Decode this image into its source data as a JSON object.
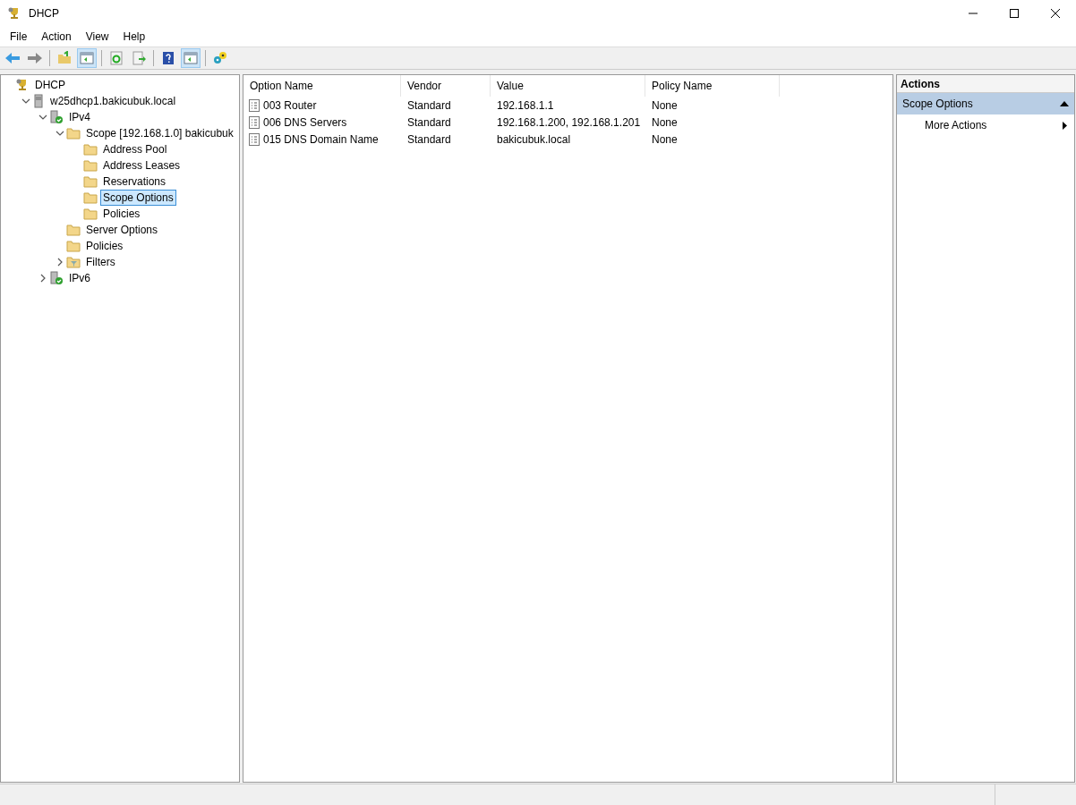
{
  "window": {
    "title": "DHCP"
  },
  "menu": [
    "File",
    "Action",
    "View",
    "Help"
  ],
  "toolbar": [
    {
      "kind": "back",
      "pressed": false
    },
    {
      "kind": "forward",
      "pressed": false
    },
    {
      "kind": "separator"
    },
    {
      "kind": "up",
      "pressed": false
    },
    {
      "kind": "pane",
      "pressed": true
    },
    {
      "kind": "separator"
    },
    {
      "kind": "refresh",
      "pressed": false
    },
    {
      "kind": "export",
      "pressed": false
    },
    {
      "kind": "separator"
    },
    {
      "kind": "help",
      "pressed": false
    },
    {
      "kind": "pane",
      "pressed": true
    },
    {
      "kind": "separator"
    },
    {
      "kind": "wizard",
      "pressed": false
    }
  ],
  "tree": [
    {
      "label": "DHCP",
      "kind": "root",
      "selected": false,
      "children": [
        {
          "label": "w25dhcp1.bakicubuk.local",
          "kind": "server",
          "expanded": true,
          "selected": false,
          "children": [
            {
              "label": "IPv4",
              "kind": "protocol",
              "expanded": true,
              "selected": false,
              "children": [
                {
                  "label": "Scope [192.168.1.0] bakicubuk",
                  "kind": "folder",
                  "expanded": true,
                  "selected": false,
                  "children": [
                    {
                      "label": "Address Pool",
                      "kind": "folder",
                      "selected": false
                    },
                    {
                      "label": "Address Leases",
                      "kind": "folder",
                      "selected": false
                    },
                    {
                      "label": "Reservations",
                      "kind": "folder",
                      "selected": false
                    },
                    {
                      "label": "Scope Options",
                      "kind": "folder",
                      "selected": true
                    },
                    {
                      "label": "Policies",
                      "kind": "folder",
                      "selected": false
                    }
                  ]
                },
                {
                  "label": "Server Options",
                  "kind": "folder",
                  "selected": false
                },
                {
                  "label": "Policies",
                  "kind": "folder",
                  "selected": false
                },
                {
                  "label": "Filters",
                  "kind": "filter",
                  "expanded": false,
                  "selected": false
                }
              ]
            },
            {
              "label": "IPv6",
              "kind": "protocol",
              "expanded": false,
              "selected": false
            }
          ]
        }
      ]
    }
  ],
  "table": {
    "columns": [
      "Option Name",
      "Vendor",
      "Value",
      "Policy Name"
    ],
    "rows": [
      [
        "003 Router",
        "Standard",
        "192.168.1.1",
        "None"
      ],
      [
        "006 DNS Servers",
        "Standard",
        "192.168.1.200, 192.168.1.201",
        "None"
      ],
      [
        "015 DNS Domain Name",
        "Standard",
        "bakicubuk.local",
        "None"
      ]
    ]
  },
  "actions": {
    "title": "Actions",
    "section": {
      "label": "Scope Options",
      "expanded": true
    },
    "items": [
      {
        "label": "More Actions"
      }
    ]
  }
}
